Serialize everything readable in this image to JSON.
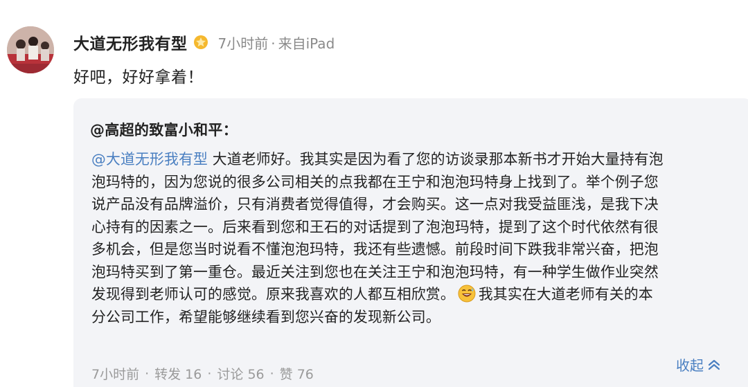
{
  "post": {
    "username": "大道无形我有型",
    "time": "7小时前",
    "source": "来自iPad",
    "content": "好吧，好好拿着！"
  },
  "quote": {
    "author": "@高超的致富小和平：",
    "mention": "@大道无形我有型",
    "lines": {
      "l1": "大道老师好。我其实是因为看了您的访谈录那本新书才开始大量持有泡",
      "l2": "泡玛特的，因为您说的很多公司相关的点我都在王宁和泡泡玛特身上找到了。举个例子您",
      "l3": "说产品没有品牌溢价，只有消费者觉得值得，才会购买。这一点对我受益匪浅，是我下决",
      "l4": "心持有的因素之一。后来看到您和王石的对话提到了泡泡玛特，提到了这个时代依然有很",
      "l5": "多机会，但是您当时说看不懂泡泡玛特，我还有些遗憾。前段时间下跌我非常兴奋，把泡",
      "l6": "泡玛特买到了第一重仓。最近关注到您也在关注王宁和泡泡玛特，有一种学生做作业突然",
      "l7a": "发现得到老师认可的感觉。原来我喜欢的人都互相欣赏。",
      "l7b": "我其实在大道老师有关的本",
      "l8": "分公司工作，希望能够继续看到您兴奋的发现新公司。"
    },
    "stats": {
      "time": "7小时前",
      "repost": "转发 16",
      "comment": "讨论 56",
      "like": "赞 76"
    },
    "collapse_label": "收起"
  },
  "icons": {
    "verified": "verified-badge-icon",
    "emoji": "grinning-sweat-emoji-icon",
    "collapse": "chevron-up-icon"
  },
  "colors": {
    "mention": "#4a7fc1",
    "meta_text": "#8a8a8a",
    "quote_bg": "#f3f4f7"
  }
}
